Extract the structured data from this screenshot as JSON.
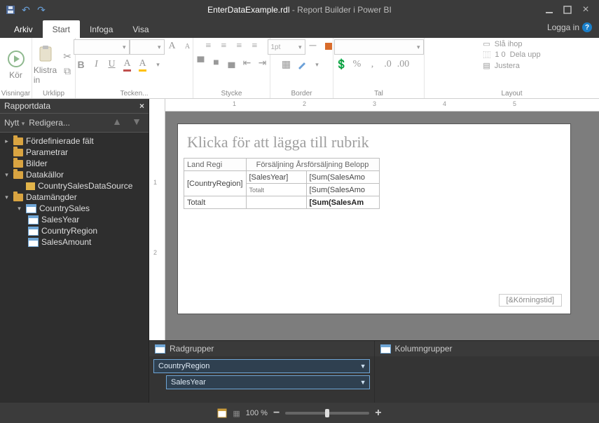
{
  "title": {
    "filename": "EnterDataExample.rdl",
    "sep": " - ",
    "app": "Report Builder i Power BI"
  },
  "login": "Logga in",
  "tabs": {
    "arkiv": "Arkiv",
    "start": "Start",
    "infoga": "Infoga",
    "visa": "Visa"
  },
  "ribbon": {
    "run": "Kör",
    "visningar": "Visningar",
    "paste": "Klistra in",
    "clipboard": "Urklipp",
    "teckensnitt": "Tecken...",
    "stycke": "Stycke",
    "border_label": "Border",
    "pt_value": "1pt",
    "tal": "Tal",
    "layout": "Layout",
    "layout_items": {
      "merge": "Slå ihop",
      "split": "Dela upp",
      "align": "Justera"
    }
  },
  "reportdata": {
    "title": "Rapportdata",
    "new": "Nytt",
    "edit": "Redigera...",
    "nodes": {
      "builtin": "Fördefinierade fält",
      "params": "Parametrar",
      "images": "Bilder",
      "datasources": "Datakällor",
      "ds1": "CountrySalesDataSource",
      "datasets": "Datamängder",
      "set1": "CountrySales",
      "f1": "SalesYear",
      "f2": "CountryRegion",
      "f3": "SalesAmount"
    }
  },
  "design": {
    "title_placeholder": "Klicka för att lägga till rubrik",
    "headers": {
      "c1": "Land Regi",
      "c2": "Försäljning Årsförsäljning Belopp"
    },
    "r1": {
      "c1": "[CountryRegion]",
      "c2": "[SalesYear]",
      "c3": "[Sum(SalesAmo"
    },
    "r2": {
      "c2": "Totalt",
      "c3": "[Sum(SalesAmo"
    },
    "r3": {
      "c1": "Totalt",
      "c3": "[Sum(SalesAm"
    },
    "footer": "[&Körningstid]"
  },
  "groups": {
    "rowgroups": "Radgrupper",
    "colgroups": "Kolumngrupper",
    "g1": "CountryRegion",
    "g2": "SalesYear"
  },
  "status": {
    "zoom": "100 %"
  },
  "ruler": {
    "m1": "1",
    "m2": "2",
    "m3": "3",
    "m4": "4",
    "m5": "5"
  }
}
